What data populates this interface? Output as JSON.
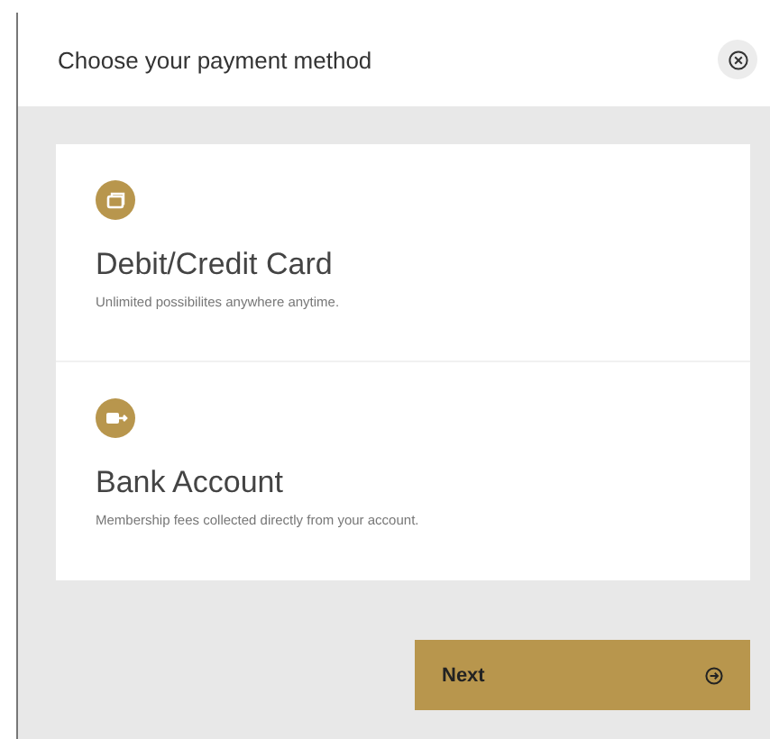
{
  "dialog": {
    "title": "Choose your payment method"
  },
  "options": [
    {
      "kind": "card",
      "title": "Debit/Credit Card",
      "description": "Unlimited possibilites anywhere anytime."
    },
    {
      "kind": "bank",
      "title": "Bank Account",
      "description": "Membership fees collected directly from your account."
    }
  ],
  "next_button": {
    "label": "Next"
  }
}
